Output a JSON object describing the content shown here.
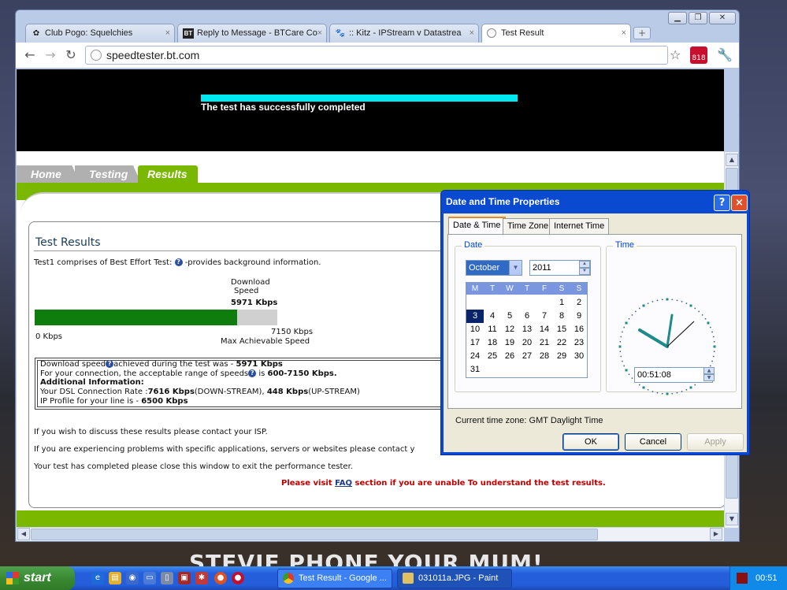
{
  "wallpaper": {
    "text": "STEVIE PHONE YOUR MUM!"
  },
  "browser": {
    "tabs": [
      {
        "label": "Club Pogo: Squelchies",
        "icon": "pogo-icon"
      },
      {
        "label": "Reply to Message - BTCare Co",
        "icon": "bt-icon",
        "icon_text": "BT"
      },
      {
        "label": ":: Kitz - IPStream v Datastrea",
        "icon": "paw-icon"
      },
      {
        "label": "Test Result",
        "icon": "globe-icon"
      }
    ],
    "address": "speedtester.bt.com",
    "badge_count": "818",
    "close_glyph": "×"
  },
  "page": {
    "banner_status": "The test has successfully completed",
    "nav_tabs": [
      "Home",
      "Testing",
      "Results"
    ],
    "section_title": "Test Results",
    "intro_prefix": "Test1 comprises of Best Effort Test:",
    "intro_suffix": "-provides background information.",
    "download_label_1": "Download",
    "download_label_2": "Speed",
    "download_value": "5971 Kbps",
    "scale_min": "0 Kbps",
    "scale_max": "7150 Kbps",
    "scale_max_label": "Max Achievable Speed",
    "speed_fraction": 0.835,
    "info": {
      "line1_prefix": "Download speed",
      "line1_mid": "achieved during the test was - ",
      "line1_value": "5971 Kbps",
      "line2_prefix": "For your connection, the acceptable range of speeds",
      "line2_mid": " is ",
      "line2_value": "600-7150 Kbps.",
      "line3": "Additional Information:",
      "line4_prefix": "Your DSL Connection Rate :",
      "line4_down": "7616 Kbps",
      "line4_down_label": "(DOWN-STREAM), ",
      "line4_up": "448 Kbps",
      "line4_up_label": "(UP-STREAM)",
      "line5_prefix": "IP Profile for your line is - ",
      "line5_value": "6500 Kbps"
    },
    "contact_isp": "If you wish to discuss these results please contact your ISP.",
    "problems": "If you are experiencing problems with specific applications, servers or websites please contact y",
    "completed": "Your test has completed please close this window to exit the performance tester.",
    "faq_prefix": "Please visit ",
    "faq_link": "FAQ",
    "faq_suffix": " section if you are unable To understand the test results."
  },
  "dialog": {
    "title": "Date and Time Properties",
    "help_glyph": "?",
    "close_glyph": "×",
    "tabs": [
      "Date & Time",
      "Time Zone",
      "Internet Time"
    ],
    "date_group": "Date",
    "time_group": "Time",
    "month": "October",
    "year": "2011",
    "weekdays": [
      "M",
      "T",
      "W",
      "T",
      "F",
      "S",
      "S"
    ],
    "weeks": [
      [
        "",
        "",
        "",
        "",
        "",
        "1",
        "2"
      ],
      [
        "3",
        "4",
        "5",
        "6",
        "7",
        "8",
        "9"
      ],
      [
        "10",
        "11",
        "12",
        "13",
        "14",
        "15",
        "16"
      ],
      [
        "17",
        "18",
        "19",
        "20",
        "21",
        "22",
        "23"
      ],
      [
        "24",
        "25",
        "26",
        "27",
        "28",
        "29",
        "30"
      ],
      [
        "31",
        "",
        "",
        "",
        "",
        "",
        ""
      ]
    ],
    "selected_day": "3",
    "time_value": "00:51:08",
    "timezone_label": "Current time zone:",
    "timezone_value": "GMT Daylight Time",
    "ok": "OK",
    "cancel": "Cancel",
    "apply": "Apply"
  },
  "taskbar": {
    "start": "start",
    "tasks": [
      {
        "label": "Test Result - Google ..."
      },
      {
        "label": "031011a.JPG - Paint"
      }
    ],
    "clock": "00:51"
  },
  "colors": {
    "accent_green": "#7ab800",
    "progress_cyan": "#00e8f0",
    "xp_blue": "#0a4ad0"
  }
}
